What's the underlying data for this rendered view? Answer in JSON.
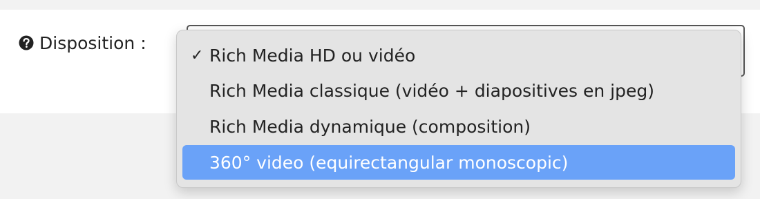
{
  "form": {
    "field_label": "Disposition :",
    "help_icon": "question-circle-icon",
    "select_value": "Rich Media HD ou vidéo"
  },
  "dropdown": {
    "selected_mark": "✓",
    "options": [
      {
        "label": "Rich Media HD ou vidéo",
        "selected": true
      },
      {
        "label": "Rich Media classique (vidéo + diapositives en jpeg)",
        "selected": false
      },
      {
        "label": "Rich Media dynamique (composition)",
        "selected": false
      },
      {
        "label": "360° video (equirectangular monoscopic)",
        "selected": false,
        "highlighted": true
      }
    ]
  },
  "colors": {
    "highlight": "#6aa2f8",
    "menu_background": "#e4e4e4",
    "page_background": "#f2f2f2"
  }
}
